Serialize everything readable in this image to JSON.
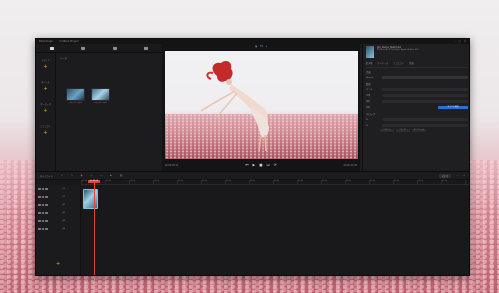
{
  "window": {
    "app_title": "Blackmagic",
    "project_title": "Untitled Project"
  },
  "toolbar": {
    "tools": [
      {
        "icon": "media-pool-icon",
        "label": ""
      },
      {
        "icon": "sync-bin-icon",
        "label": ""
      },
      {
        "icon": "transitions-icon",
        "label": ""
      },
      {
        "icon": "titles-icon",
        "label": ""
      }
    ]
  },
  "sidebar": {
    "groups": [
      {
        "label": "メディア"
      },
      {
        "label": "タイトル"
      },
      {
        "label": "オーディオ"
      },
      {
        "label": "エフェクト"
      }
    ]
  },
  "media": {
    "header": "ソース",
    "clips": [
      {
        "name": "clip_01.mp4"
      },
      {
        "name": "clip_02.mp4"
      }
    ]
  },
  "preview": {
    "zoom": "Fit",
    "timecode_left": "00:00:05:12",
    "timecode_right": "00:00:25:00"
  },
  "inspector": {
    "clip_title": "girl_dance_field.mp4",
    "clip_sub": "1920x1080 | 25.00fps | Apple ProRes 422",
    "tabs": [
      "ビデオ",
      "オーディオ",
      "エフェクト",
      "情報"
    ],
    "sections": [
      {
        "title": "合成",
        "rows": [
          {
            "label": "Normal"
          }
        ]
      },
      {
        "title": "変形",
        "rows": [
          {
            "label": "ズーム"
          },
          {
            "label": "位置"
          },
          {
            "label": "回転"
          },
          {
            "label": "反転"
          }
        ]
      },
      {
        "title": "クロップ",
        "rows": [
          {
            "label": "左"
          },
          {
            "label": "右"
          }
        ]
      }
    ],
    "apply_label": "すべてに適用",
    "mini_buttons": [
      "リセット",
      "ソース",
      "キーフレーム"
    ]
  },
  "timeline": {
    "toolbar_label": "タイムライン",
    "record_label": "●",
    "right_pill": "ビデオ",
    "playhead_time": "00:00:05",
    "ruler_ticks": [
      "00:00",
      "00:05",
      "00:10",
      "00:15",
      "00:20",
      "00:25",
      "00:30",
      "00:35",
      "00:40",
      "00:45",
      "00:50",
      "00:55",
      "01:00",
      "01:05",
      "01:10",
      "01:15"
    ],
    "tracks": [
      {
        "name": "V2"
      },
      {
        "name": "V1"
      },
      {
        "name": "A1"
      },
      {
        "name": "A2"
      },
      {
        "name": "A3"
      },
      {
        "name": "A4"
      }
    ]
  }
}
